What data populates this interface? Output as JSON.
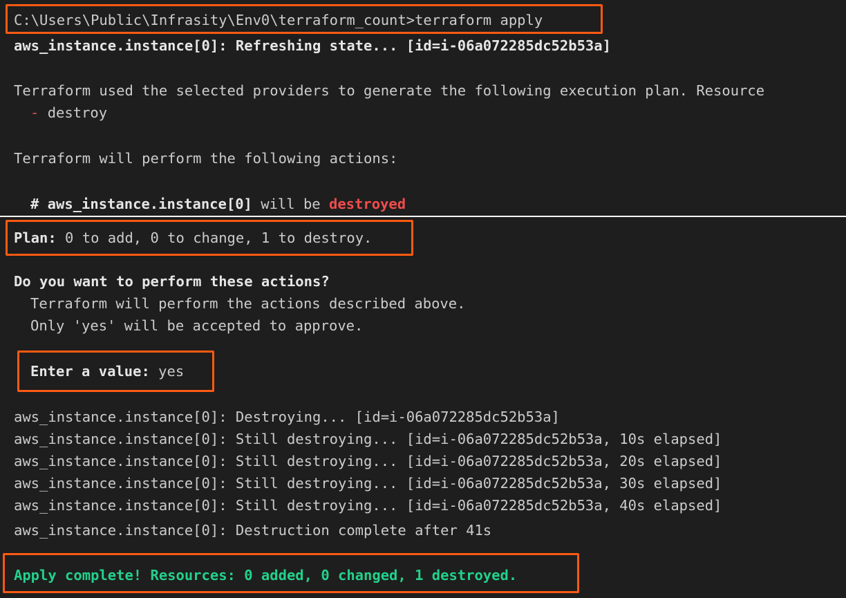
{
  "colors": {
    "terminal_bg": "#1e1e1e",
    "text": "#cccccc",
    "destroy_red": "#f14c4c",
    "success_green": "#23d18b",
    "highlight_orange": "#ff5a12"
  },
  "top": {
    "command": "C:\\Users\\Public\\Infrasity\\Env0\\terraform_count>terraform apply",
    "refresh_line": "aws_instance.instance[0]: Refreshing state... [id=i-06a072285dc52b53a]",
    "plan_intro": "Terraform used the selected providers to generate the following execution plan. Resource",
    "destroy_symbol": "-",
    "destroy_word": "destroy",
    "actions_line": "Terraform will perform the following actions:",
    "resource_header": "# aws_instance.instance[0]",
    "will_be": " will be ",
    "destroyed_word": "destroyed"
  },
  "bottom": {
    "plan_label": "Plan:",
    "plan_text": " 0 to add, 0 to change, 1 to destroy.",
    "question": "Do you want to perform these actions?",
    "desc1": "Terraform will perform the actions described above.",
    "desc2": "Only 'yes' will be accepted to approve.",
    "enter_label": "Enter a value:",
    "enter_value": " yes",
    "log_lines": [
      "aws_instance.instance[0]: Destroying... [id=i-06a072285dc52b53a]",
      "aws_instance.instance[0]: Still destroying... [id=i-06a072285dc52b53a, 10s elapsed]",
      "aws_instance.instance[0]: Still destroying... [id=i-06a072285dc52b53a, 20s elapsed]",
      "aws_instance.instance[0]: Still destroying... [id=i-06a072285dc52b53a, 30s elapsed]",
      "aws_instance.instance[0]: Still destroying... [id=i-06a072285dc52b53a, 40s elapsed]",
      "aws_instance.instance[0]: Destruction complete after 41s"
    ],
    "apply_complete": "Apply complete! Resources: 0 added, 0 changed, 1 destroyed."
  }
}
